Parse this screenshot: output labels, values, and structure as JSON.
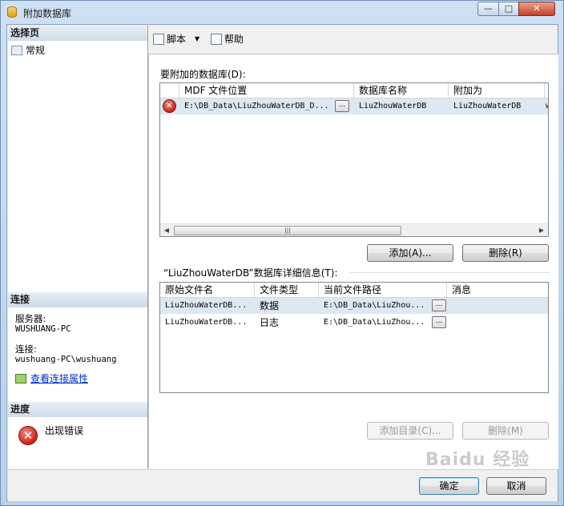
{
  "window": {
    "title": "附加数据库",
    "min_glyph": "—",
    "max_glyph": "□",
    "close_glyph": "✕"
  },
  "left": {
    "select_page_header": "选择页",
    "pages": [
      {
        "label": "常规"
      }
    ],
    "connection_header": "连接",
    "server_label": "服务器:",
    "server_value": "WUSHUANG-PC",
    "connection_label": "连接:",
    "connection_value": "wushuang-PC\\wushuang",
    "view_props_link": "查看连接属性",
    "progress_header": "进度",
    "progress_status": "出现错误"
  },
  "toolbar": {
    "script_label": "脚本",
    "script_dropdown": "▼",
    "help_label": "帮助"
  },
  "attach": {
    "label": "要附加的数据库(D):",
    "columns": [
      "MDF 文件位置",
      "数据库名称",
      "附加为",
      "所"
    ],
    "rows": [
      {
        "status": "✕",
        "mdf": "E:\\DB_Data\\LiuZhouWaterDB_D...",
        "browse": "...",
        "db_name": "LiuZhouWaterDB",
        "attach_as": "LiuZhouWaterDB",
        "owner": "w"
      }
    ],
    "scroll_left": "◀",
    "scroll_right": "▶",
    "scroll_grip": "|||",
    "add_button": "添加(A)...",
    "remove_button": "删除(R)"
  },
  "details": {
    "label": "“LiuZhouWaterDB”数据库详细信息(T):",
    "columns": [
      "原始文件名",
      "文件类型",
      "当前文件路径",
      "消息"
    ],
    "rows": [
      {
        "file": "LiuZhouWaterDB...",
        "type": "数据",
        "path": "E:\\DB_Data\\LiuZhou...",
        "browse": "...",
        "message": ""
      },
      {
        "file": "LiuZhouWaterDB...",
        "type": "日志",
        "path": "E:\\DB_Data\\LiuZhou...",
        "browse": "...",
        "message": ""
      }
    ],
    "add_catalog_button": "添加目录(C)...",
    "remove_button": "删除(M)"
  },
  "footer": {
    "ok_button": "确定",
    "cancel_button": "取消"
  },
  "watermark": "Baidu 经验"
}
